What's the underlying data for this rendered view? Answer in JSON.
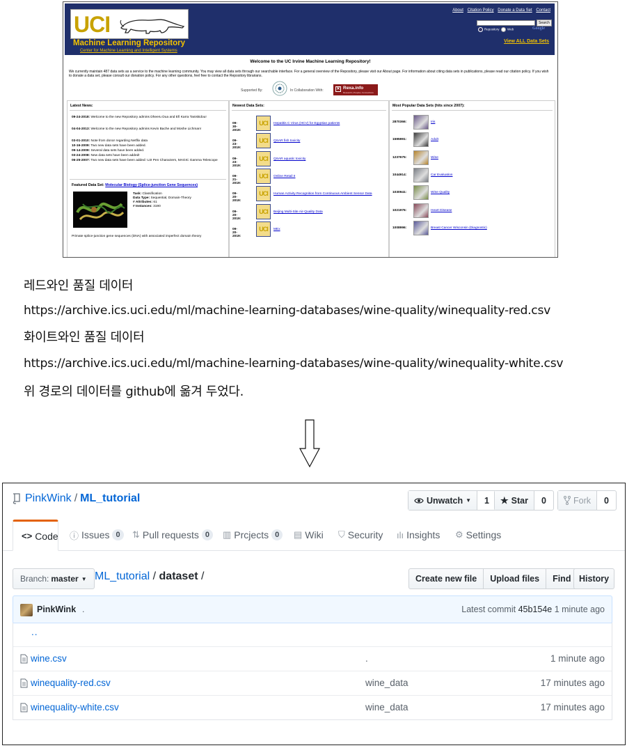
{
  "uci": {
    "logo_text": "UCI",
    "title": "Machine Learning Repository",
    "subtitle": "Center for Machine Learning and Intelligent Systems",
    "top_links": [
      "About",
      "Citation Policy",
      "Donate a Data Set",
      "Contact"
    ],
    "search_button": "Search",
    "radio_repository": "Repository",
    "radio_web": "Web",
    "search_provider": "Google",
    "view_all": "View ALL Data Sets",
    "welcome": "Welcome to the UC Irvine Machine Learning Repository!",
    "intro": "We currently maintain 487 data sets as a service to the machine learning community. You may view all data sets through our searchable interface. For a general overview of the Repository, please visit our About page. For information about citing data sets in publications, please read our citation policy. If you wish to donate a data set, please consult our donation policy. For any other questions, feel free to contact the Repository librarians.",
    "supported_by": "Supported By:",
    "in_collaboration": "In Collaboration With:",
    "rexa_label": "Rexa.info",
    "rexa_sub": "Research | People | Connections",
    "latest_news": {
      "heading": "Latest News:",
      "items": [
        {
          "date": "09-24-2018:",
          "text": "Welcome to the new Repository admins Dheeru Dua and Efi Karra Taniskidou!"
        },
        {
          "date": "04-04-2013:",
          "text": "Welcome to the new Repository admins Kevin Bache and Moshe Lichman!"
        },
        {
          "date": "03-01-2010:",
          "text": "Note from donor regarding Netflix data"
        },
        {
          "date": "10-16-2009:",
          "text": "Two new data sets have been added."
        },
        {
          "date": "09-14-2009:",
          "text": "Several data sets have been added."
        },
        {
          "date": "03-24-2008:",
          "text": "New data sets have been added!"
        },
        {
          "date": "06-25-2007:",
          "text": "Two new data sets have been added: UJI Pen Characters, MAGIC Gamma Telescope"
        }
      ]
    },
    "featured": {
      "label": "Featured Data Set:",
      "name": "Molecular Biology (Splice-junction Gene Sequences)",
      "task_label": "Task:",
      "task": "Classification",
      "type_label": "Data Type:",
      "type": "Sequential, Domain-Theory",
      "attr_label": "# Attributes:",
      "attributes": "61",
      "inst_label": "# Instances:",
      "instances": "3190",
      "description": "Primate splice-junction gene sequences (DNA) with associated imperfect domain theory"
    },
    "newest": {
      "heading": "Newest Data Sets:",
      "items": [
        {
          "date": "09-30-2019:",
          "name": "Hepatitis C Virus (HCV) for Egyptian patients"
        },
        {
          "date": "09-23-2019:",
          "name": "QSAR fish toxicity"
        },
        {
          "date": "09-23-2019:",
          "name": "QSAR aquatic toxicity"
        },
        {
          "date": "09-21-2019:",
          "name": "Online Retail II"
        },
        {
          "date": "09-20-2019:",
          "name": "Human Activity Recognition from Continuous Ambient Sensor Data"
        },
        {
          "date": "09-20-2019:",
          "name": "Beijing Multi-Site Air-Quality Data"
        },
        {
          "date": "09-20-2019:",
          "name": "MEx"
        }
      ]
    },
    "popular": {
      "heading": "Most Popular Data Sets (hits since 2007):",
      "items": [
        {
          "count": "2870366:",
          "name": "Iris",
          "color": "#6a5a8a"
        },
        {
          "count": "1595991:",
          "name": "Adult",
          "color": "#3d3d3d"
        },
        {
          "count": "1237675:",
          "name": "Wine",
          "color": "#b8862d"
        },
        {
          "count": "1044914:",
          "name": "Car Evaluation",
          "color": "#7a7f86"
        },
        {
          "count": "1030941:",
          "name": "Wine Quality",
          "color": "#7a8f4a"
        },
        {
          "count": "1021976:",
          "name": "Heart Disease",
          "color": "#8a4a5a"
        },
        {
          "count": "1008996:",
          "name": "Breast Cancer Wisconsin (Diagnostic)",
          "color": "#5a5a9a"
        }
      ]
    }
  },
  "notes": {
    "red_label": "레드와인 품질 데이터",
    "red_url": "https://archive.ics.uci.edu/ml/machine-learning-databases/wine-quality/winequality-red.csv",
    "white_label": "화이트와인 품질 데이터",
    "white_url": "https://archive.ics.uci.edu/ml/machine-learning-databases/wine-quality/winequality-white.csv",
    "moved_note": "위 경로의 데이터를 github에 옮겨 두었다."
  },
  "github": {
    "owner": "PinkWink",
    "repo": "ML_tutorial",
    "watch_label": "Unwatch",
    "watch_count": "1",
    "star_label": "Star",
    "star_count": "0",
    "fork_label": "Fork",
    "fork_count": "0",
    "tabs": {
      "code": "Code",
      "issues": "Issues",
      "issues_count": "0",
      "pulls": "Pull requests",
      "pulls_count": "0",
      "projects": "Prcjects",
      "projects_count": "0",
      "wiki": "Wiki",
      "security": "Security",
      "insights": "Insights",
      "settings": "Settings"
    },
    "branch_label": "Branch:",
    "branch": "master",
    "path_root": "ML_tutorial",
    "path_sep": "/",
    "path_leaf": "dataset",
    "path_trail": "/",
    "actions": {
      "create": "Create new file",
      "upload": "Upload files",
      "find": "Find file",
      "history": "History"
    },
    "commit": {
      "author": "PinkWink",
      "message": ".",
      "latest_label": "Latest commit",
      "sha": "45b154e",
      "age": "1 minute ago"
    },
    "parent_dir": "..",
    "files": [
      {
        "name": "wine.csv",
        "message": ".",
        "age": "1 minute ago"
      },
      {
        "name": "winequality-red.csv",
        "message": "wine_data",
        "age": "17 minutes ago"
      },
      {
        "name": "winequality-white.csv",
        "message": "wine_data",
        "age": "17 minutes ago"
      }
    ]
  }
}
